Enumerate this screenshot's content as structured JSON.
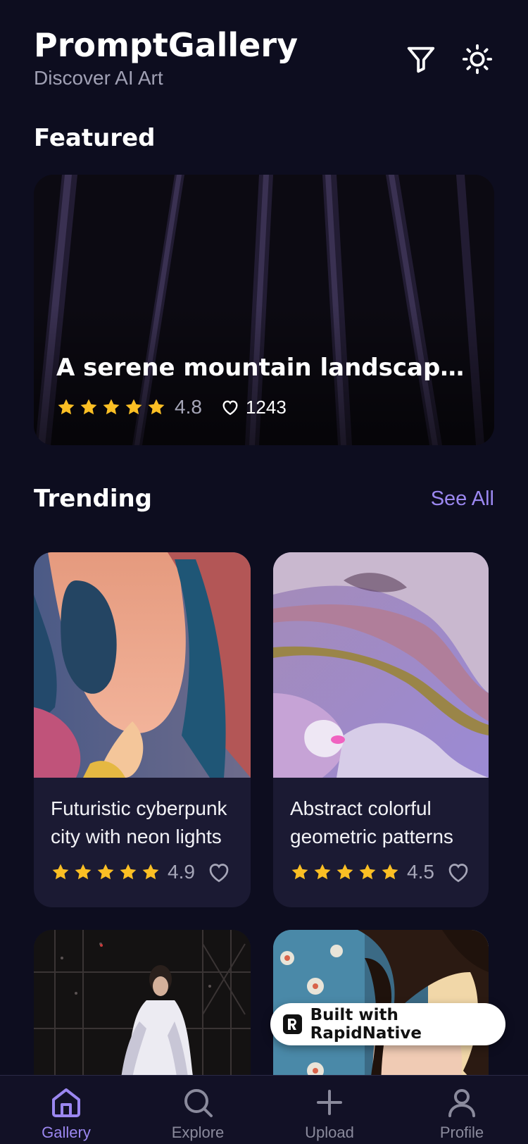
{
  "header": {
    "title": "PromptGallery",
    "subtitle": "Discover AI Art",
    "icons": [
      "filter-icon",
      "sun-icon"
    ]
  },
  "featured": {
    "section_title": "Featured",
    "caption": "A serene mountain landscape at sunset",
    "rating": "4.8",
    "stars": 5,
    "likes": "1243"
  },
  "trending": {
    "section_title": "Trending",
    "see_all": "See All",
    "cards": [
      {
        "caption": "Futuristic cyberpunk city with neon lights",
        "rating": "4.9"
      },
      {
        "caption": "Abstract colorful geometric patterns",
        "rating": "4.5"
      },
      {
        "caption": "",
        "rating": ""
      },
      {
        "caption": "",
        "rating": ""
      }
    ]
  },
  "badge": {
    "label": "Built with RapidNative"
  },
  "tabs": [
    {
      "label": "Gallery",
      "icon": "home-icon",
      "active": true
    },
    {
      "label": "Explore",
      "icon": "search-icon",
      "active": false
    },
    {
      "label": "Upload",
      "icon": "plus-icon",
      "active": false
    },
    {
      "label": "Profile",
      "icon": "user-icon",
      "active": false
    }
  ],
  "colors": {
    "background": "#0d0d1f",
    "card": "#1b1a33",
    "accent": "#9b87f0",
    "star": "#fbbf24",
    "muted": "#a0a0b4"
  }
}
